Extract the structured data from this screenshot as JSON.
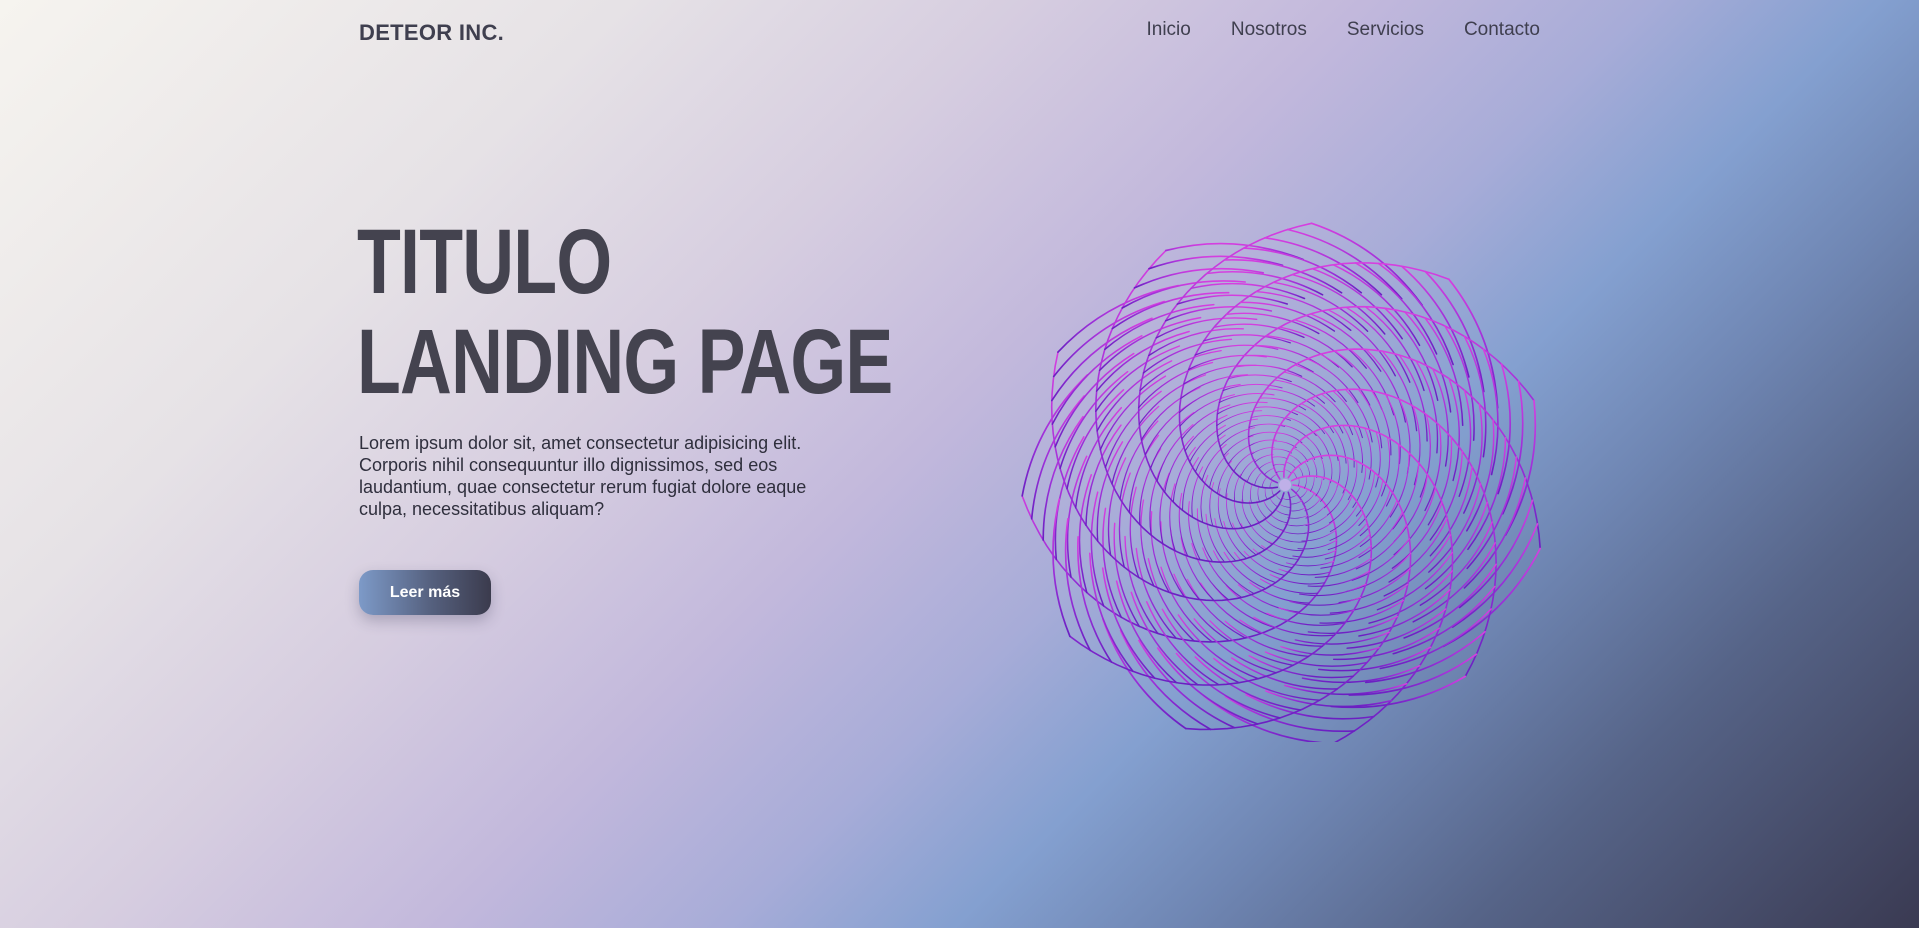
{
  "header": {
    "brand": "DETEOR INC.",
    "nav": [
      "Inicio",
      "Nosotros",
      "Servicios",
      "Contacto"
    ]
  },
  "hero": {
    "title_line1": "TITULO",
    "title_line2": "LANDING PAGE",
    "description": "Lorem ipsum dolor sit, amet consectetur adipisicing elit. Corporis nihil consequuntur illo dignissimos, sed eos laudantium, quae consectetur rerum fugiat dolore eaque culpa, necessitatibus aliquam?",
    "cta_label": "Leer más"
  },
  "illustration": {
    "name": "spiral-graphic",
    "colors": {
      "top": "#d63fe0",
      "bottom": "#6a1fc2",
      "center": "#bfb0e8"
    }
  }
}
